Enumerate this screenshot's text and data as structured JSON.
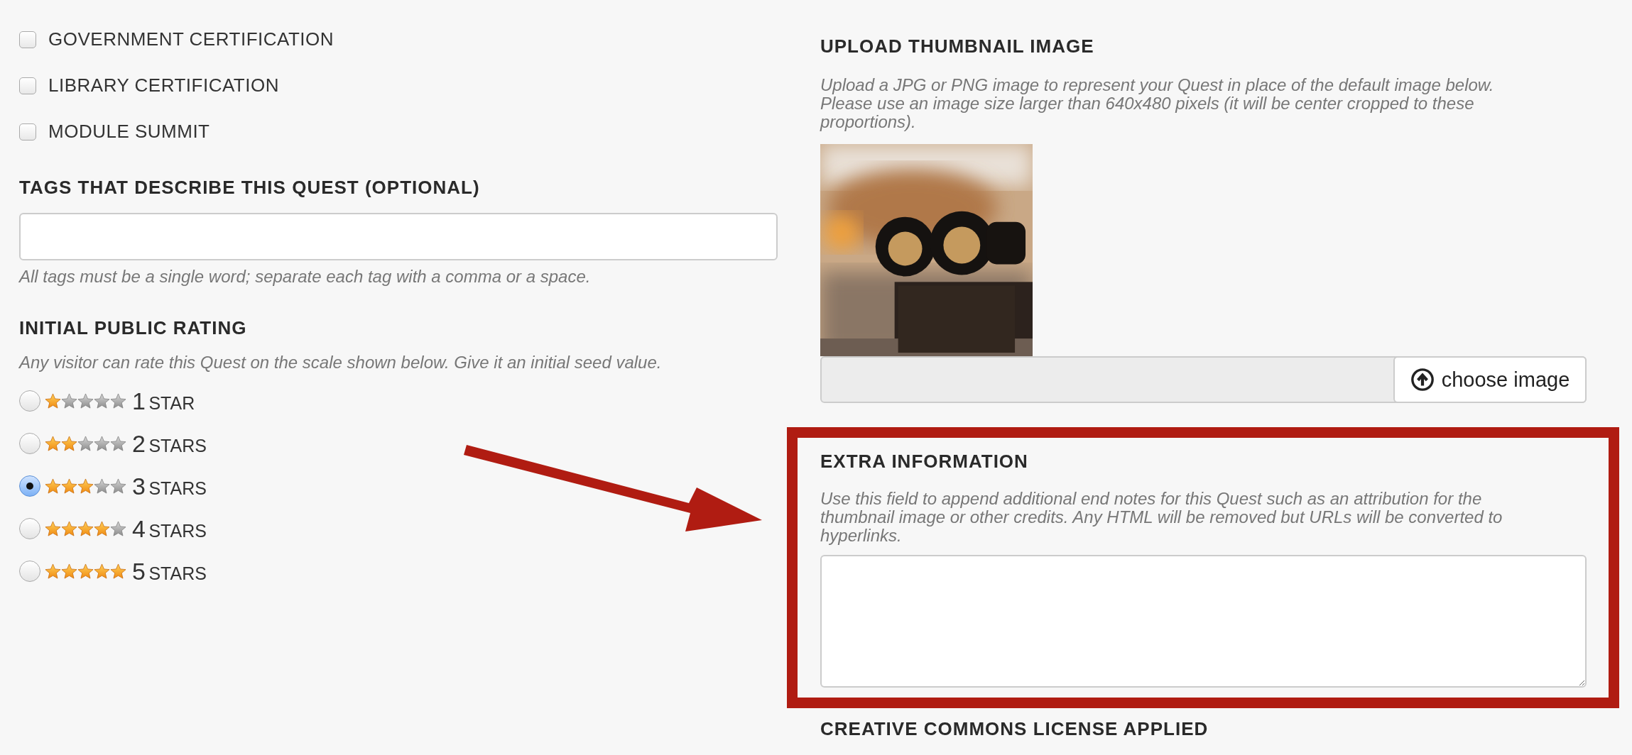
{
  "left": {
    "categories": [
      {
        "label": "GOVERNMENT CERTIFICATION",
        "checked": false
      },
      {
        "label": "LIBRARY CERTIFICATION",
        "checked": false
      },
      {
        "label": "MODULE SUMMIT",
        "checked": false
      }
    ],
    "tags": {
      "heading": "TAGS THAT DESCRIBE THIS QUEST (OPTIONAL)",
      "help": "All tags must be a single word; separate each tag with a comma or a space."
    },
    "rating": {
      "heading": "INITIAL PUBLIC RATING",
      "help": "Any visitor can rate this Quest on the scale shown below. Give it an initial seed value.",
      "options": [
        {
          "number": "1",
          "unit": "STAR",
          "stars": 1,
          "selected": false
        },
        {
          "number": "2",
          "unit": "STARS",
          "stars": 2,
          "selected": false
        },
        {
          "number": "3",
          "unit": "STARS",
          "stars": 3,
          "selected": true
        },
        {
          "number": "4",
          "unit": "STARS",
          "stars": 4,
          "selected": false
        },
        {
          "number": "5",
          "unit": "STARS",
          "stars": 5,
          "selected": false
        }
      ]
    }
  },
  "right": {
    "thumbnail": {
      "heading": "UPLOAD THUMBNAIL IMAGE",
      "help": "Upload a JPG or PNG image to represent your Quest in place of the default image below. Please use an image size larger than 640x480 pixels (it will be center cropped to these proportions).",
      "button": "choose image"
    },
    "extra": {
      "heading": "EXTRA INFORMATION",
      "help": "Use this field to append additional end notes for this Quest such as an attribution for the thumbnail image or other credits. Any HTML will be removed but URLs will be converted to hyperlinks."
    },
    "license": {
      "heading": "CREATIVE COMMONS LICENSE APPLIED"
    }
  }
}
